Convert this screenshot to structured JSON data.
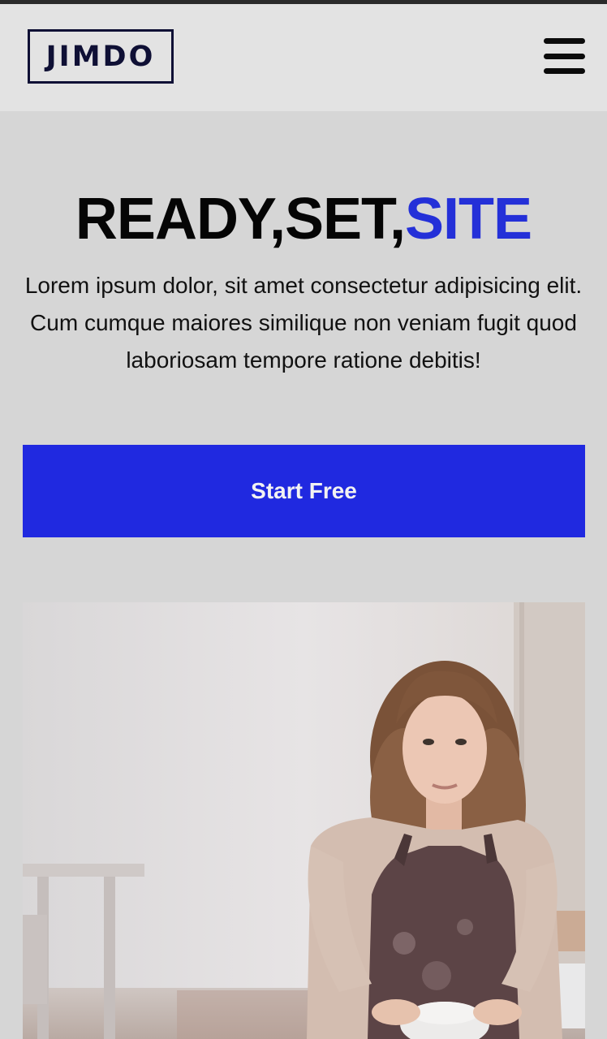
{
  "header": {
    "logo_text": "JIMDO",
    "menu_icon": "hamburger-menu-icon"
  },
  "hero": {
    "headline_part1": "READY,SET,",
    "headline_accent": "SITE",
    "lead": "Lorem ipsum dolor, sit amet consectetur adipisicing elit. Cum cumque maiores similique non veniam fugit quod laboriosam tempore ratione debitis!",
    "cta_label": "Start Free"
  },
  "colors": {
    "accent": "#2029e0",
    "page_background": "#d6d6d6",
    "header_background": "#e3e3e3",
    "logo": "#0f1035"
  }
}
